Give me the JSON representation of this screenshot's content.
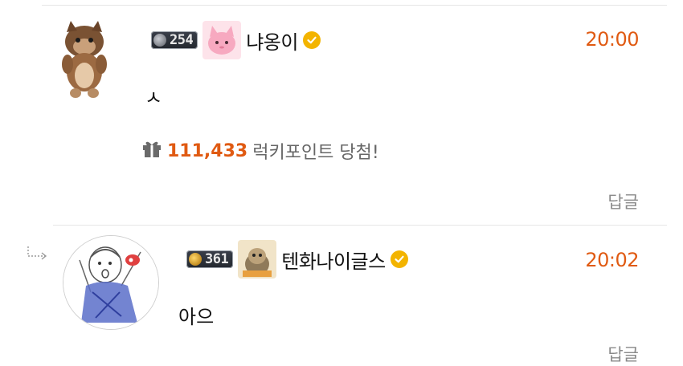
{
  "comments": [
    {
      "level": "254",
      "nickname": "냐옹이",
      "time": "20:00",
      "text": "ㅅ",
      "lucky": {
        "amount": "111,433",
        "label": "럭키포인트 당첨!"
      },
      "reply_label": "답글"
    },
    {
      "level": "361",
      "nickname": "텐화나이글스",
      "time": "20:02",
      "text": "아으",
      "reply_label": "답글"
    }
  ],
  "icons": {
    "level": "level-gem-icon",
    "verified": "verified-check-icon",
    "gift": "gift-icon",
    "reply_arrow": "reply-arrow-icon"
  },
  "colors": {
    "accent": "#e05a12",
    "verified": "#f3b400",
    "muted": "#8a8a8a",
    "divider": "#e6e6e6"
  }
}
